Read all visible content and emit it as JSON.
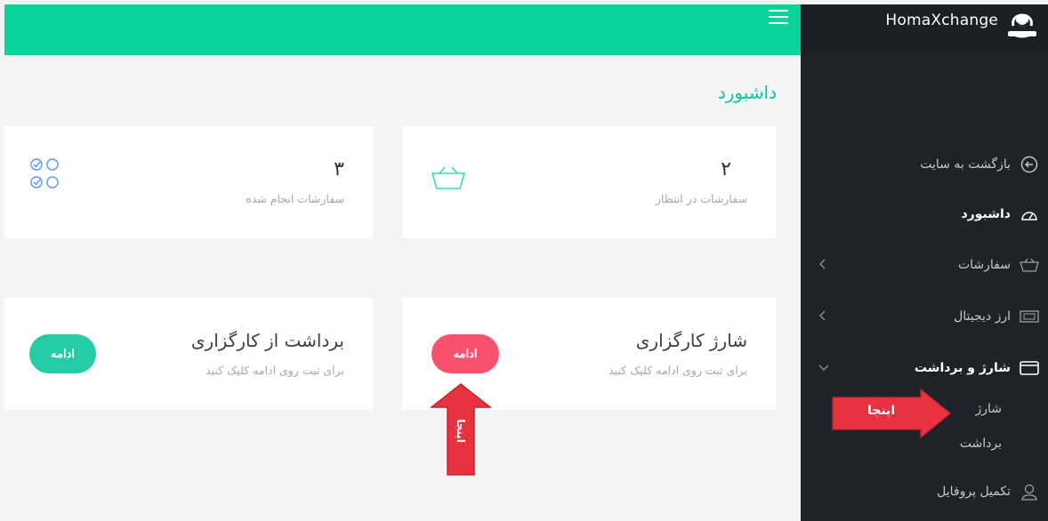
{
  "brand": {
    "name": "HomaXchange"
  },
  "page": {
    "title": "داشبورد"
  },
  "sidebar": {
    "items": [
      {
        "label": "بازگشت به سایت",
        "icon": "back-circle-icon"
      },
      {
        "label": "داشبورد",
        "icon": "speedometer-icon",
        "active": true
      },
      {
        "label": "سفارشات",
        "icon": "basket-icon",
        "has_submenu": true
      },
      {
        "label": "ارز دیجیتال",
        "icon": "banknote-icon",
        "has_submenu": true
      },
      {
        "label": "شارژ و برداشت",
        "icon": "credit-card-icon",
        "expanded": true
      },
      {
        "label": "تکمیل پروفایل",
        "icon": "user-icon"
      }
    ],
    "subitems": [
      {
        "label": "شارژ"
      },
      {
        "label": "برداشت"
      }
    ]
  },
  "stats": [
    {
      "value": "۲",
      "label": "سفارشات در انتظار",
      "icon": "basket-icon"
    },
    {
      "value": "۳",
      "label": "سفارشات انجام شده",
      "icon": "check-circles-icon"
    }
  ],
  "actions": [
    {
      "title": "شارژ کارگزاری",
      "subtitle": "برای ثبت روی ادامه کلیک کنید",
      "button": "ادامه"
    },
    {
      "title": "برداشت از کارگزاری",
      "subtitle": "برای ثبت روی ادامه کلیک کنید",
      "button": "ادامه"
    }
  ],
  "annotations": {
    "side_label": "اینجا",
    "up_label": "اینجا"
  },
  "colors": {
    "accent_green": "#07d39b",
    "sidebar_bg": "#1e2329",
    "button_red": "#f6526d",
    "button_green": "#25cda6",
    "annotation_red": "#e9323f"
  }
}
